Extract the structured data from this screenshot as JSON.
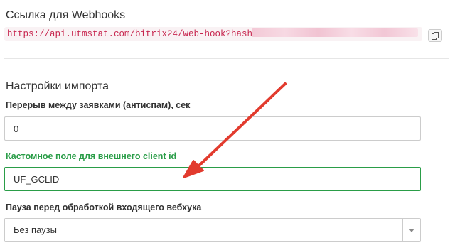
{
  "webhook_section": {
    "title": "Ссылка для Webhooks",
    "url_prefix": "https://api.utmstat.com/bitrix24/web-hook?hash="
  },
  "import_section": {
    "title": "Настройки импорта",
    "fields": {
      "antispam": {
        "label": "Перерыв между заявками (антиспам), сек",
        "value": "0"
      },
      "client_id": {
        "label": "Кастомное поле для внешнего client id",
        "value": "UF_GCLID"
      },
      "pause": {
        "label": "Пауза перед обработкой входящего вебхука",
        "selected": "Без паузы"
      }
    }
  },
  "colors": {
    "success": "#2a9d48",
    "annotation_arrow": "#e23b2e",
    "code_text": "#c7254e"
  },
  "icons": {
    "copy": "copy-icon",
    "dropdown": "chevron-down-icon"
  }
}
